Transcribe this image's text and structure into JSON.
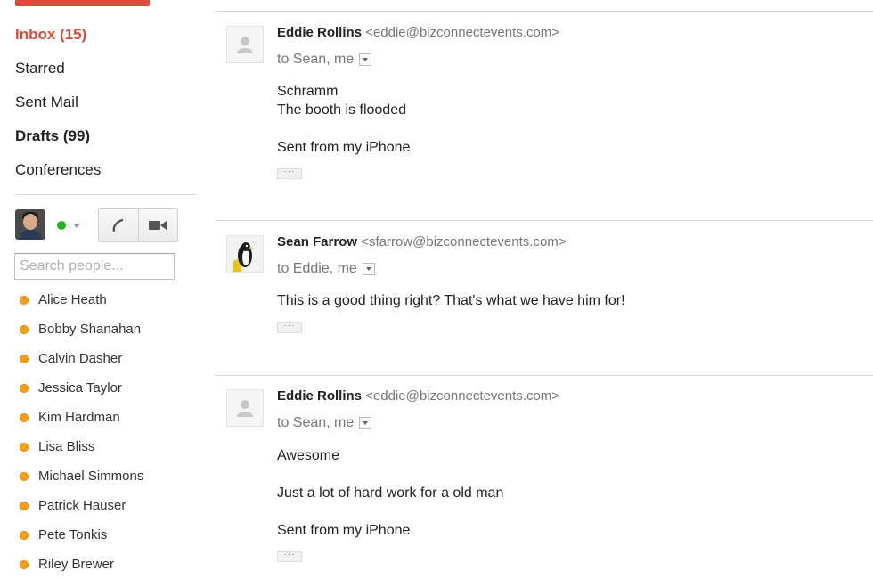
{
  "nav": {
    "items": [
      {
        "label": "Inbox (15)",
        "style": "inbox"
      },
      {
        "label": "Starred",
        "style": ""
      },
      {
        "label": "Sent Mail",
        "style": ""
      },
      {
        "label": "Drafts (99)",
        "style": "bold"
      },
      {
        "label": "Conferences",
        "style": ""
      }
    ]
  },
  "chat": {
    "status_color": "#1fb71f",
    "search_placeholder": "Search people...",
    "contacts": [
      "Alice Heath",
      "Bobby Shanahan",
      "Calvin Dasher",
      "Jessica Taylor",
      "Kim Hardman",
      "Lisa Bliss",
      "Michael Simmons",
      "Patrick Hauser",
      "Pete Tonkis",
      "Riley Brewer"
    ],
    "contact_status_color": "#f7a11b"
  },
  "messages": [
    {
      "sender": "Eddie Rollins",
      "email": "<eddie@bizconnectevents.com>",
      "recipients": "to Sean, me",
      "avatar": "placeholder-avatar-icon",
      "lines": [
        "Schramm",
        "The booth is flooded",
        "",
        "Sent from my iPhone"
      ]
    },
    {
      "sender": "Sean Farrow",
      "email": "<sfarrow@bizconnectevents.com>",
      "recipients": "to Eddie, me",
      "avatar": "penguin-avatar",
      "lines": [
        "This is a good thing right? That's what we have him for!"
      ]
    },
    {
      "sender": "Eddie Rollins",
      "email": "<eddie@bizconnectevents.com>",
      "recipients": "to Sean, me",
      "avatar": "placeholder-avatar-icon",
      "lines": [
        "Awesome",
        "",
        "Just a lot of hard work for a old man",
        "",
        "Sent from my iPhone"
      ]
    }
  ],
  "colors": {
    "accent": "#dd4b39",
    "separator": "#d8d8d8"
  }
}
